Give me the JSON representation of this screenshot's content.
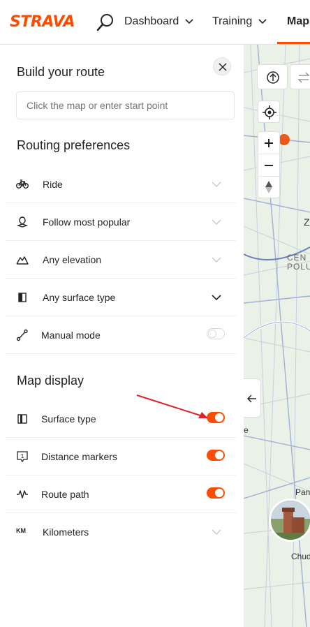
{
  "nav": {
    "logo": "STRAVA",
    "items": [
      {
        "label": "Dashboard"
      },
      {
        "label": "Training"
      },
      {
        "label": "Maps"
      }
    ]
  },
  "panel": {
    "title": "Build your route",
    "start_placeholder": "Click the map or enter start point",
    "routing_heading": "Routing preferences",
    "routing": [
      {
        "icon": "bike-icon",
        "label": "Ride"
      },
      {
        "icon": "popularity-icon",
        "label": "Follow most popular"
      },
      {
        "icon": "elevation-icon",
        "label": "Any elevation"
      },
      {
        "icon": "surface-icon",
        "label": "Any surface type"
      },
      {
        "icon": "manual-mode-icon",
        "label": "Manual mode",
        "toggle": false
      }
    ],
    "map_display_heading": "Map display",
    "map_display": [
      {
        "icon": "surface-type-icon",
        "label": "Surface type",
        "toggle": true
      },
      {
        "icon": "distance-markers-icon",
        "label": "Distance markers",
        "toggle": true
      },
      {
        "icon": "route-path-icon",
        "label": "Route path",
        "toggle": true
      },
      {
        "icon": "units-icon",
        "label": "Kilometers",
        "units_glyph": "KM"
      }
    ]
  },
  "map": {
    "labels": [
      "Z",
      "CEN",
      "POLU",
      "e",
      "Pan",
      "Chud"
    ]
  },
  "colors": {
    "accent": "#fc4c02",
    "annotation_arrow": "#d6262b"
  }
}
